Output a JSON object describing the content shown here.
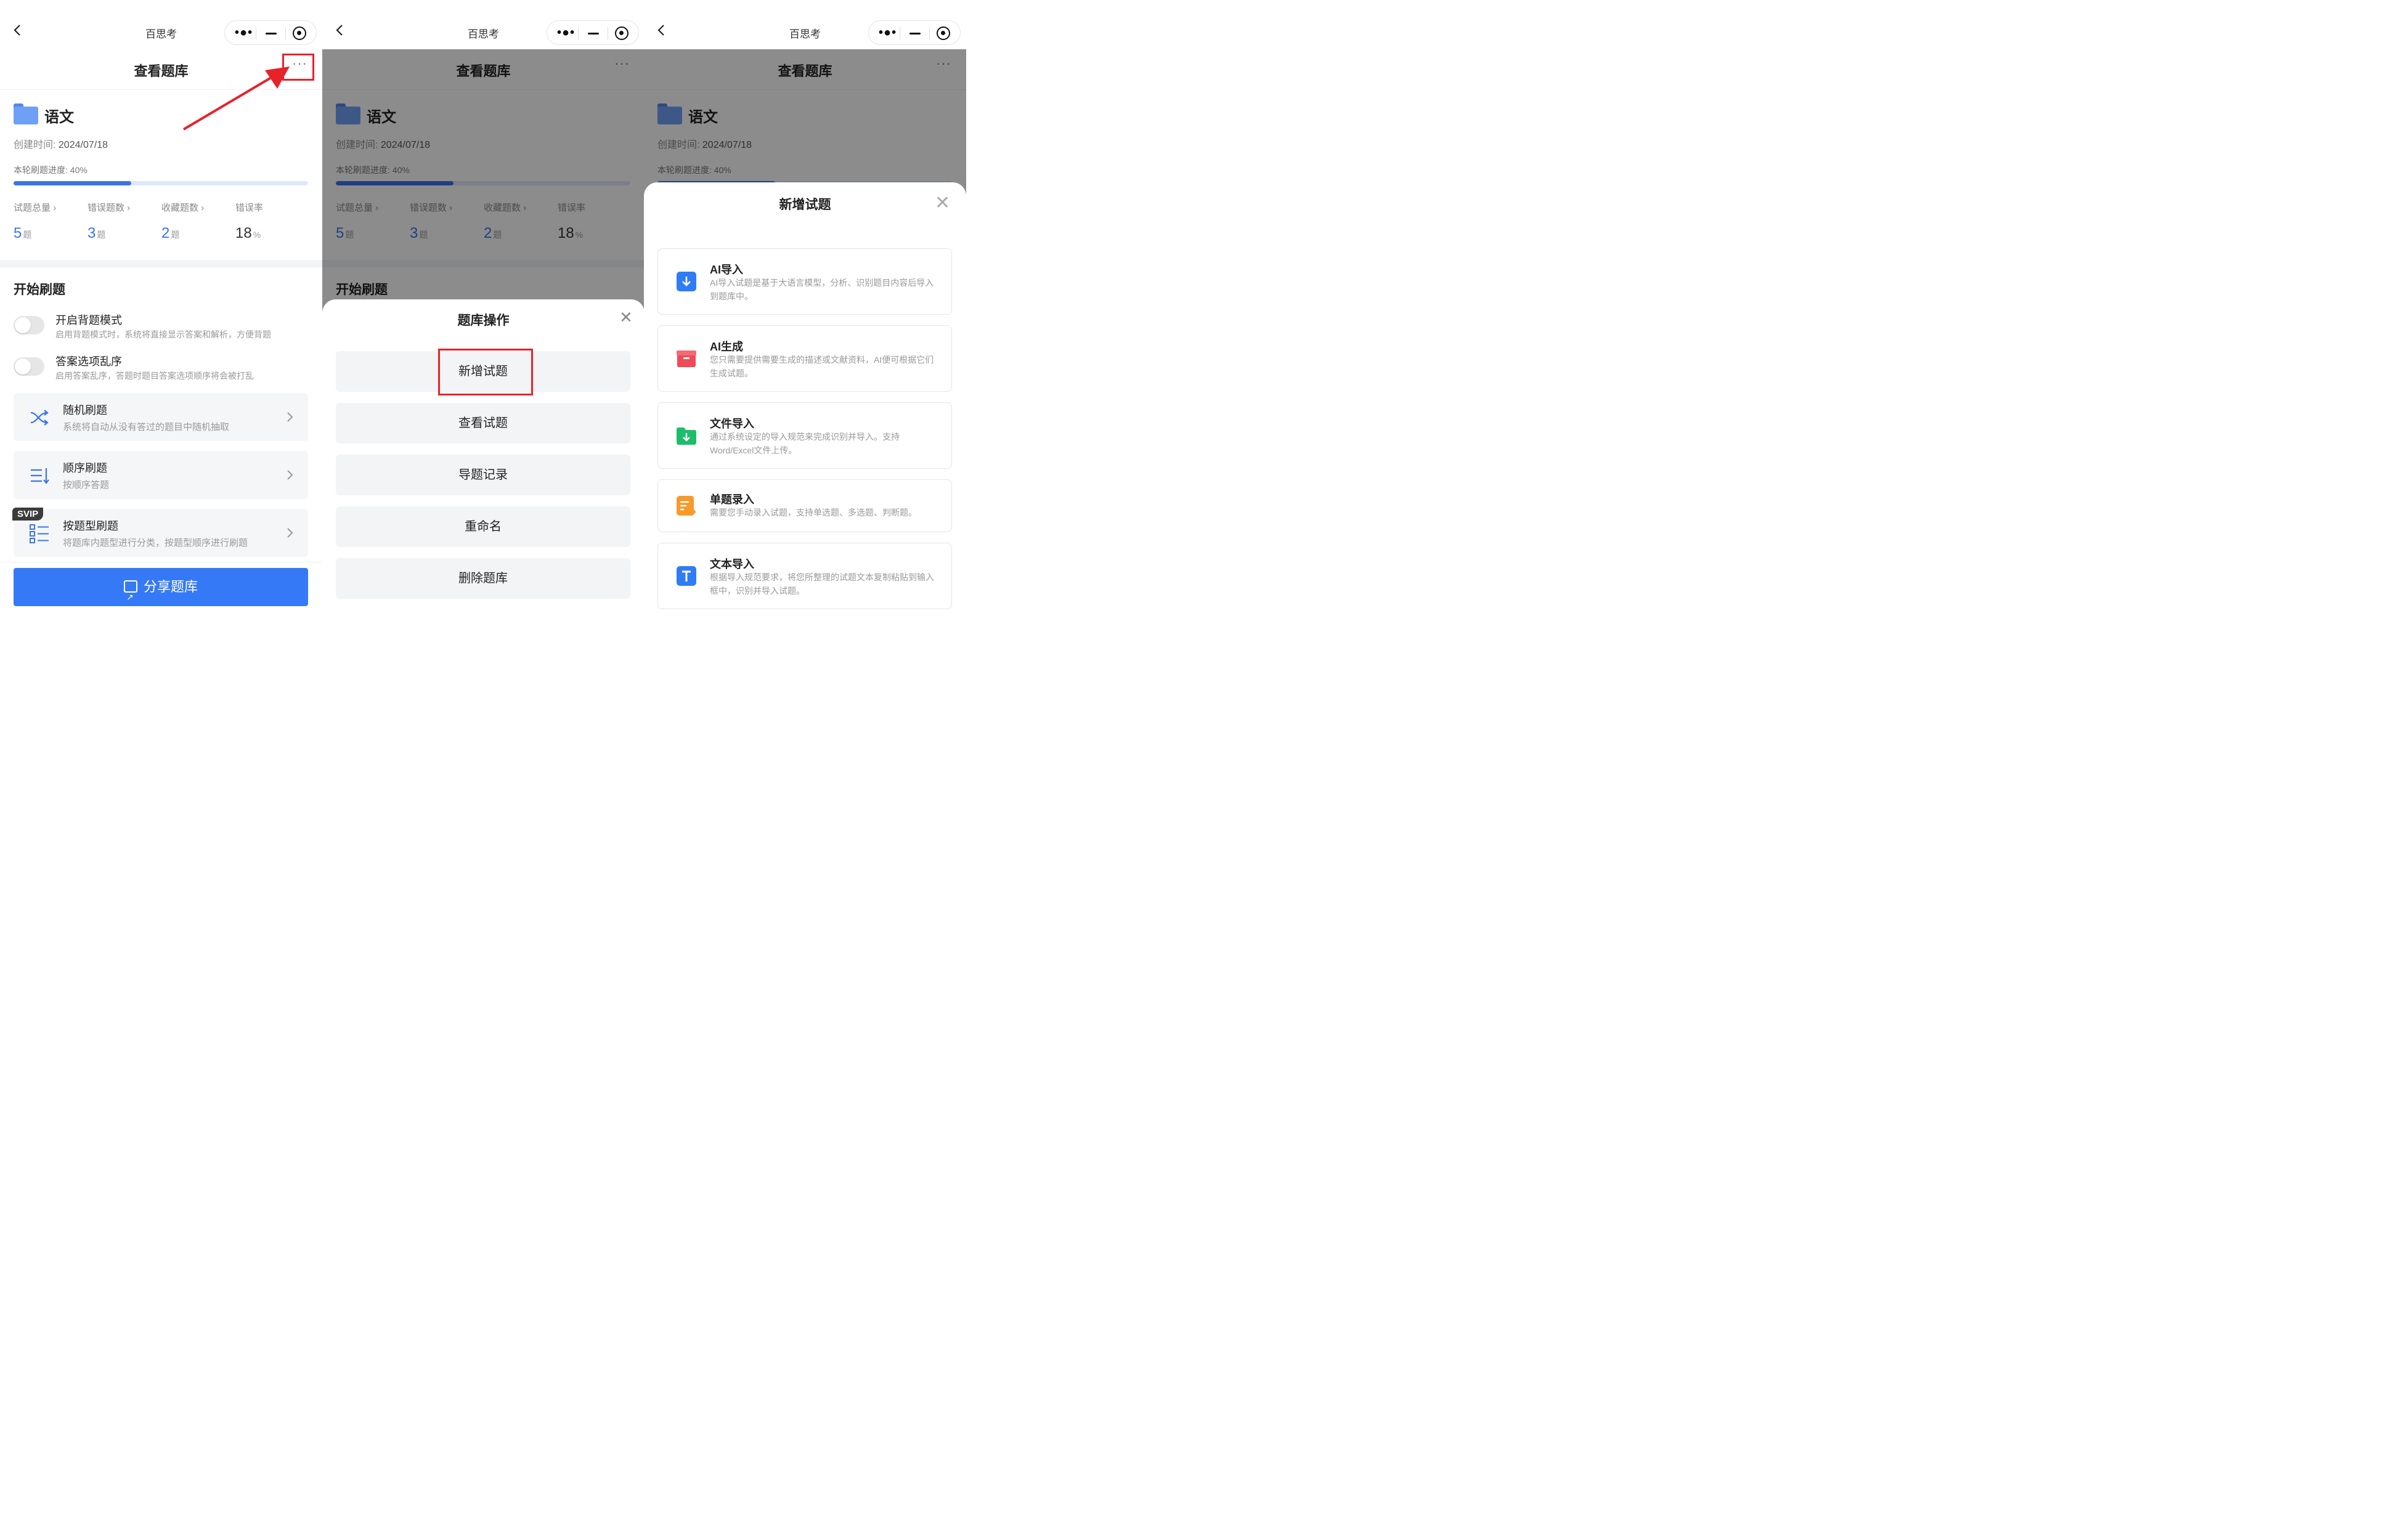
{
  "app_title": "百思考",
  "page_title": "查看题库",
  "bank": {
    "name": "语文",
    "created_label": "创建时间:",
    "created_date": "2024/07/18",
    "progress_label": "本轮刷题进度: 40%",
    "progress_fraction": 0.4
  },
  "stats": [
    {
      "label": "试题总量 ›",
      "value": "5",
      "unit": "题"
    },
    {
      "label": "错误题数 ›",
      "value": "3",
      "unit": "题"
    },
    {
      "label": "收藏题数 ›",
      "value": "2",
      "unit": "题"
    },
    {
      "label": "错误率",
      "value": "18",
      "unit": "%"
    }
  ],
  "practice": {
    "section_title": "开始刷题",
    "options": [
      {
        "title": "开启背题模式",
        "desc": "启用背题模式时，系统将直接显示答案和解析，方便背题"
      },
      {
        "title": "答案选项乱序",
        "desc": "启用答案乱序，答题时题目答案选项顺序将会被打乱"
      }
    ],
    "cards": [
      {
        "title": "随机刷题",
        "desc": "系统将自动从没有答过的题目中随机抽取",
        "icon": "shuffle-icon"
      },
      {
        "title": "顺序刷题",
        "desc": "按顺序答题",
        "icon": "list-order-icon"
      },
      {
        "title": "按题型刷题",
        "desc": "将题库内题型进行分类，按题型顺序进行刷题",
        "icon": "category-icon",
        "badge": "SVIP"
      }
    ]
  },
  "share_button": "分享题库",
  "ops_sheet": {
    "title": "题库操作",
    "buttons": [
      "新增试题",
      "查看试题",
      "导题记录",
      "重命名",
      "删除题库"
    ]
  },
  "add_sheet": {
    "title": "新增试题",
    "items": [
      {
        "title": "AI导入",
        "desc": "AI导入试题是基于大语言模型，分析、识别题目内容后导入到题库中。",
        "icon": "ai-import-icon",
        "color": "#2f7cf6"
      },
      {
        "title": "AI生成",
        "desc": "您只需要提供需要生成的描述或文献资料，AI便可根据它们生成试题。",
        "icon": "ai-generate-icon",
        "color": "#ef4a55"
      },
      {
        "title": "文件导入",
        "desc": "通过系统设定的导入规范来完成识别并导入。支持Word/Excel文件上传。",
        "icon": "file-import-icon",
        "color": "#1ebd6b"
      },
      {
        "title": "单题录入",
        "desc": "需要您手动录入试题，支持单选题、多选题、判断题。",
        "icon": "single-entry-icon",
        "color": "#f79a2a"
      },
      {
        "title": "文本导入",
        "desc": "根据导入规范要求，将您所整理的试题文本复制粘贴到输入框中，识别并导入试题。",
        "icon": "text-import-icon",
        "color": "#2f7cf6"
      }
    ]
  },
  "colors": {
    "accent": "#3579f6",
    "annotation": "#e8222b"
  }
}
